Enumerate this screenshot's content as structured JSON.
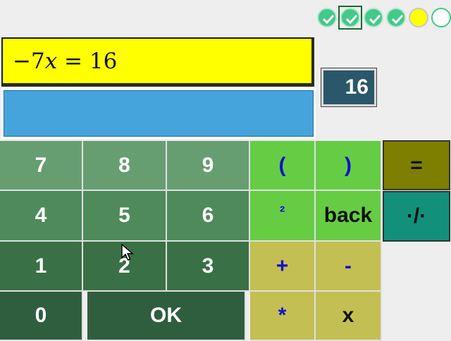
{
  "progress": [
    {
      "state": "done",
      "icon": "check-icon"
    },
    {
      "state": "done-current",
      "icon": "check-icon"
    },
    {
      "state": "done",
      "icon": "check-icon"
    },
    {
      "state": "done",
      "icon": "check-icon"
    },
    {
      "state": "current"
    },
    {
      "state": "empty"
    }
  ],
  "equation": {
    "minus": "−",
    "coef": "7",
    "var": "x",
    "rest": " = 16"
  },
  "answer": {
    "value": ""
  },
  "target": {
    "value": "16"
  },
  "keypad": {
    "k7": "7",
    "k8": "8",
    "k9": "9",
    "lparen": "(",
    "rparen": ")",
    "equals": "=",
    "k4": "4",
    "k5": "5",
    "k6": "6",
    "square": "²",
    "back": "back",
    "fraction": "·/·",
    "k1": "1",
    "k2": "2",
    "k3": "3",
    "plus": "+",
    "minus": "-",
    "k0": "0",
    "ok": "OK",
    "times": "*",
    "x": "x"
  },
  "colors": {
    "equation_bg": "#ffff00",
    "answer_bg": "#45a4dc",
    "target_bg": "#2a5769",
    "progress_done": "#44c98a"
  }
}
